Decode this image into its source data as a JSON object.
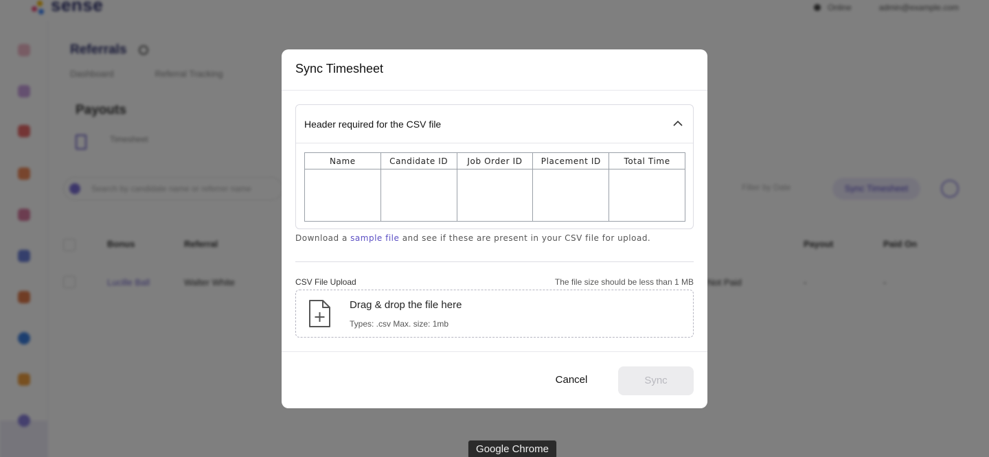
{
  "app": {
    "logo_text": "sense",
    "top_right": {
      "status": "Online",
      "user": "admin@example.com"
    },
    "page_title": "Referrals",
    "tabs": [
      "Dashboard",
      "Referral Tracking"
    ],
    "section_title": "Payouts",
    "subtab": "Timesheet",
    "search_placeholder": "Search by candidate name or referrer name",
    "filter_label": "Filter by Date",
    "sync_button": "Sync Timesheet",
    "table": {
      "headers": [
        "Bonus",
        "Referral",
        "Payout",
        "Paid On"
      ],
      "row": [
        "Lucille Ball",
        "Walter White",
        "Not Paid",
        "-",
        "-"
      ]
    }
  },
  "modal": {
    "title": "Sync Timesheet",
    "accordion_title": "Header required for the CSV file",
    "columns": [
      "Name",
      "Candidate ID",
      "Job Order ID",
      "Placement ID",
      "Total Time"
    ],
    "download_note": {
      "prefix": "Download a",
      "link": "sample file",
      "suffix": "and see if these are present in your CSV file for upload."
    },
    "upload_label": "CSV File Upload",
    "upload_limit": "The file size should be less than 1 MB",
    "drop_title": "Drag & drop the file here",
    "drop_types": "Types: .csv Max. size: 1mb",
    "cancel_label": "Cancel",
    "sync_label": "Sync"
  },
  "tooltip": "Google Chrome",
  "colors": {
    "brand": "#2b2e6b",
    "accent": "#5b4fc4",
    "overlay": "rgba(0,0,0,0.5)",
    "disabled_button": "#ececee",
    "disabled_text": "#b9b9bf"
  }
}
